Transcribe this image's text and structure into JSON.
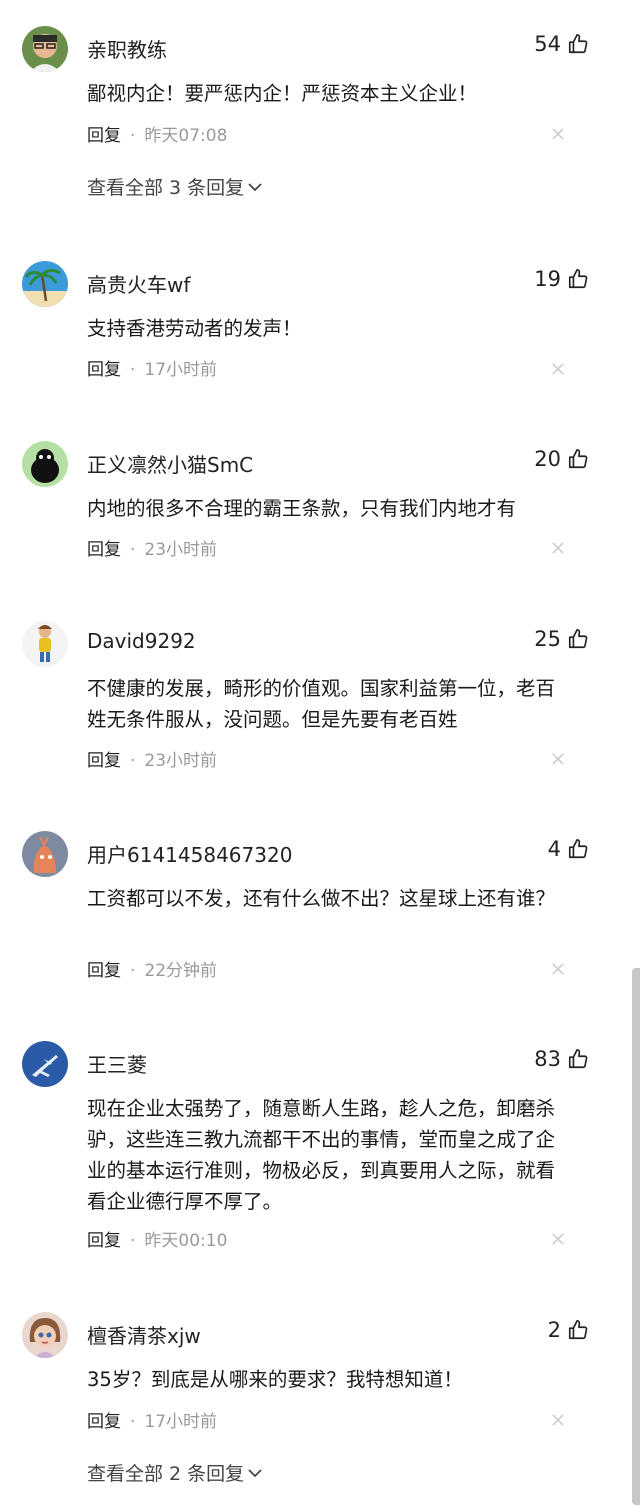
{
  "comments": [
    {
      "user": "亲职教练",
      "likes": "54",
      "text": "鄙视内企！要严惩内企！严惩资本主义企业！",
      "reply": "回复",
      "dot": "·",
      "time": "昨天07:08",
      "more": "查看全部 3 条回复",
      "avatar_icon": "man-portrait-avatar-icon",
      "avatar_bg": "#6a8f4a"
    },
    {
      "user": "高贵火车wf",
      "likes": "19",
      "text": "支持香港劳动者的发声！",
      "reply": "回复",
      "dot": "·",
      "time": "17小时前",
      "avatar_icon": "palm-tree-avatar-icon",
      "avatar_bg": "#3a9bd8"
    },
    {
      "user": "正义凛然小猫SmC",
      "likes": "20",
      "text": "内地的很多不合理的霸王条款，只有我们内地才有",
      "reply": "回复",
      "dot": "·",
      "time": "23小时前",
      "avatar_icon": "black-bird-avatar-icon",
      "avatar_bg": "#b5e0a5"
    },
    {
      "user": "David9292",
      "likes": "25",
      "text": "不健康的发展，畸形的价值观。国家利益第一位，老百姓无条件服从，没问题。但是先要有老百姓",
      "reply": "回复",
      "dot": "·",
      "time": "23小时前",
      "avatar_icon": "cartoon-figure-avatar-icon",
      "avatar_bg": "#f4f4f4"
    },
    {
      "user": "用户6141458467320",
      "likes": "4",
      "text": "工资都可以不发，还有什么做不出？这星球上还有谁？",
      "reply": "回复",
      "dot": "·",
      "time": "22分钟前",
      "avatar_icon": "orange-creature-avatar-icon",
      "avatar_bg": "#7d8aa0"
    },
    {
      "user": "王三菱",
      "likes": "83",
      "text": "现在企业太强势了，随意断人生路，趁人之危，卸磨杀驴，这些连三教九流都干不出的事情，堂而皇之成了企业的基本运行准则，物极必反，到真要用人之际，就看看企业德行厚不厚了。",
      "reply": "回复",
      "dot": "·",
      "time": "昨天00:10",
      "avatar_icon": "jet-plane-avatar-icon",
      "avatar_bg": "#2b5aa8"
    },
    {
      "user": "檀香清茶xjw",
      "likes": "2",
      "text": "35岁？到底是从哪来的要求？我特想知道！",
      "reply": "回复",
      "dot": "·",
      "time": "17小时前",
      "more": "查看全部 2 条回复",
      "avatar_icon": "cartoon-girl-avatar-icon",
      "avatar_bg": "#e9d6cf"
    }
  ]
}
